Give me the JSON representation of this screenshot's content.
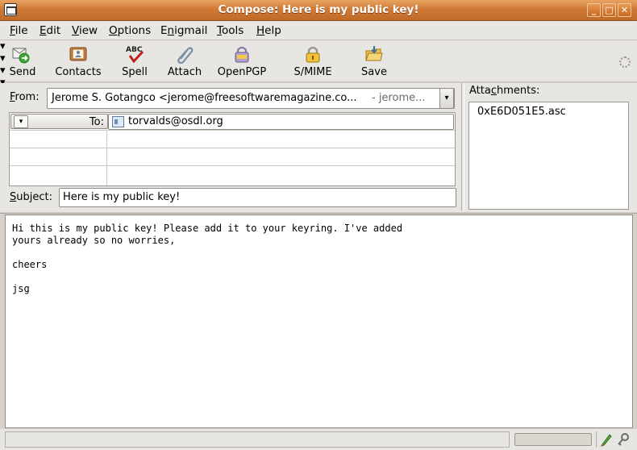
{
  "window": {
    "title": "Compose: Here is my public key!",
    "minimize_glyph": "_",
    "maximize_glyph": "□",
    "close_glyph": "✕"
  },
  "menu": [
    {
      "accel": "F",
      "rest": "ile"
    },
    {
      "accel": "E",
      "rest": "dit"
    },
    {
      "accel": "V",
      "rest": "iew"
    },
    {
      "accel": "O",
      "rest": "ptions"
    },
    {
      "pre": "E",
      "accel": "n",
      "rest": "igmail"
    },
    {
      "accel": "T",
      "rest": "ools"
    },
    {
      "accel": "H",
      "rest": "elp"
    }
  ],
  "toolbar": {
    "send": "Send",
    "contacts": "Contacts",
    "spell": "Spell",
    "spell_icon_text": "ABC",
    "attach": "Attach",
    "openpgp": "OpenPGP",
    "smime": "S/MIME",
    "save": "Save",
    "dropdown_glyph": "▾"
  },
  "header": {
    "from_label_accel": "F",
    "from_label_rest": "rom:",
    "from_value": "Jerome S. Gotangco <jerome@freesoftwaremagazine.co...",
    "from_account": "- jerome...",
    "to_label": "To:",
    "to_value": "torvalds@osdl.org",
    "subject_label_accel": "S",
    "subject_label_rest": "ubject:",
    "subject_value": "Here is my public key!",
    "attachments_label_pre": "Atta",
    "attachments_label_accel": "c",
    "attachments_label_rest": "hments:",
    "attachments": [
      "0xE6D051E5.asc"
    ]
  },
  "body": {
    "text": "Hi this is my public key! Please add it to your keyring. I've added\nyours already so no worries,\n\ncheers\n\njsg"
  },
  "colors": {
    "titlebar": "#cf7a36",
    "chrome": "#e8e6e2"
  }
}
